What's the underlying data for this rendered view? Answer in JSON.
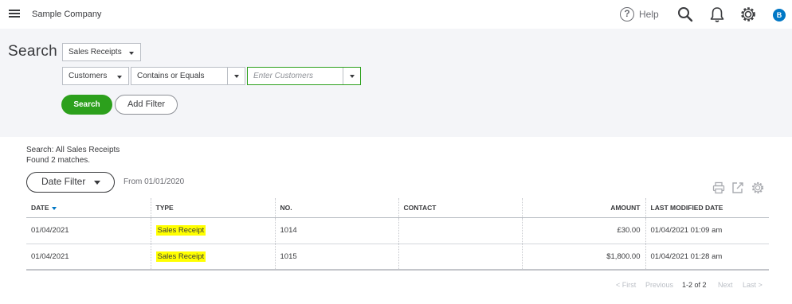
{
  "header": {
    "company": "Sample Company",
    "help_label": "Help",
    "avatar_initial": "B",
    "icons": [
      "menu-icon",
      "help-icon",
      "search-icon",
      "bell-icon",
      "gear-icon"
    ]
  },
  "search_panel": {
    "title": "Search",
    "type_select": "Sales Receipts",
    "field_select": "Customers",
    "operator_select": "Contains or Equals",
    "value_placeholder": "Enter Customers",
    "search_button": "Search",
    "add_filter_button": "Add Filter"
  },
  "results": {
    "summary": "Search: All Sales Receipts",
    "found": "Found 2 matches.",
    "date_filter_button": "Date Filter",
    "from_text": "From 01/01/2020",
    "columns": [
      "DATE",
      "TYPE",
      "NO.",
      "CONTACT",
      "AMOUNT",
      "LAST MODIFIED DATE"
    ],
    "rows": [
      {
        "date": "01/04/2021",
        "type": "Sales Receipt",
        "no": "1014",
        "contact": "",
        "amount": "£30.00",
        "modified": "01/04/2021 01:09 am"
      },
      {
        "date": "01/04/2021",
        "type": "Sales Receipt",
        "no": "1015",
        "contact": "",
        "amount": "$1,800.00",
        "modified": "01/04/2021 01:28 am"
      }
    ]
  },
  "pagination": {
    "first": "< First",
    "previous": "Previous",
    "range": "1-2 of 2",
    "next": "Next",
    "last": "Last >"
  },
  "colors": {
    "accent_green": "#2ca01c",
    "highlight": "#ffff00",
    "avatar_blue": "#0077c5"
  }
}
